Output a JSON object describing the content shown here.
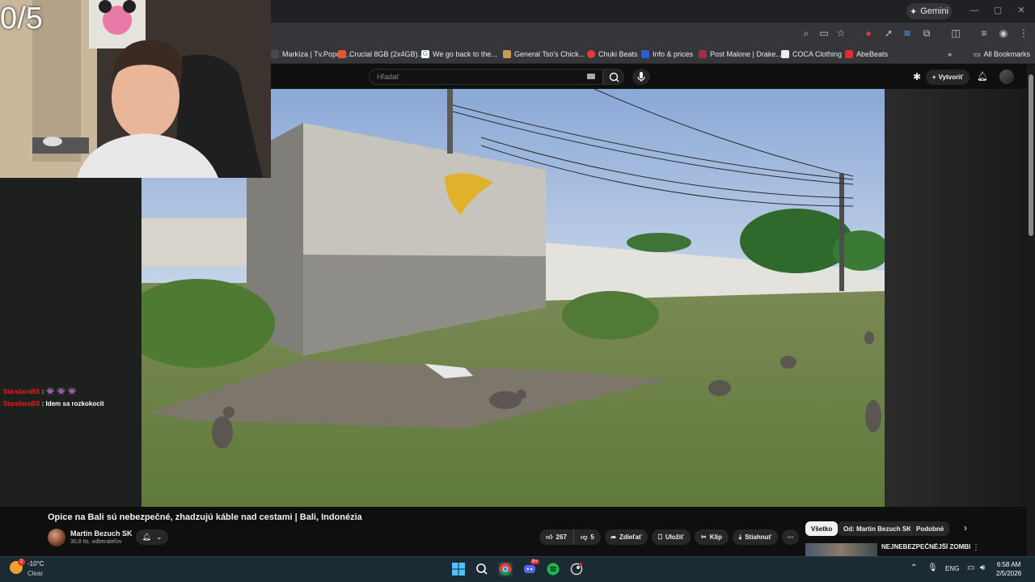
{
  "overlay": {
    "counter": "0/5"
  },
  "browser": {
    "gemini_label": "Gemini",
    "bookmarks": [
      {
        "label": "Markíza | Tv.Popcor...",
        "color": "#4a4a4a"
      },
      {
        "label": "Crucial 8GB (2x4GB)...",
        "color": "#e8542e"
      },
      {
        "label": "We go back to the...",
        "color": "#4285f4"
      },
      {
        "label": "General Tso's Chick...",
        "color": "#c89b5a"
      },
      {
        "label": "Chuki Beats",
        "color": "#e33b3b"
      },
      {
        "label": "Info & prices",
        "color": "#2f5bd6"
      },
      {
        "label": "Post Malone | Drake...",
        "color": "#a0304a"
      },
      {
        "label": "COCA Clothing",
        "color": "#222222"
      },
      {
        "label": "AbeBeats",
        "color": "#e02e2e"
      }
    ],
    "all_bookmarks": "All Bookmarks"
  },
  "youtube": {
    "search_placeholder": "Hľadať",
    "create_label": "Vytvoriť",
    "video_title": "Opice na Bali sú nebezpečné, zhadzujú káble nad cestami | Bali, Indonézia",
    "channel_name": "Martin Bezuch SK",
    "subscribers": "30,8 tis. odberateľov",
    "likes": "267",
    "dislikes": "5",
    "share": "Zdieľať",
    "save": "Uložiť",
    "clip": "Klip",
    "download": "Stiahnuť",
    "chips": [
      "Všetko",
      "Od: Martin Bezuch SK",
      "Podobné"
    ],
    "rec_title": "NEJNEBEZPEČNĚJŠÍ ZOMBIE VIRUS - Deranged Rehmáns..."
  },
  "chat": [
    {
      "user": "StandaraBS",
      "msg": ""
    },
    {
      "user": "StandaraBS",
      "msg": "Idem sa rozkokocit"
    }
  ],
  "taskbar": {
    "temp": "-10°C",
    "weather": "Clear",
    "weather_badge": "2",
    "lang": "ENG",
    "time": "6:58 AM",
    "date": "2/5/2026",
    "discord_badge": "9+"
  }
}
